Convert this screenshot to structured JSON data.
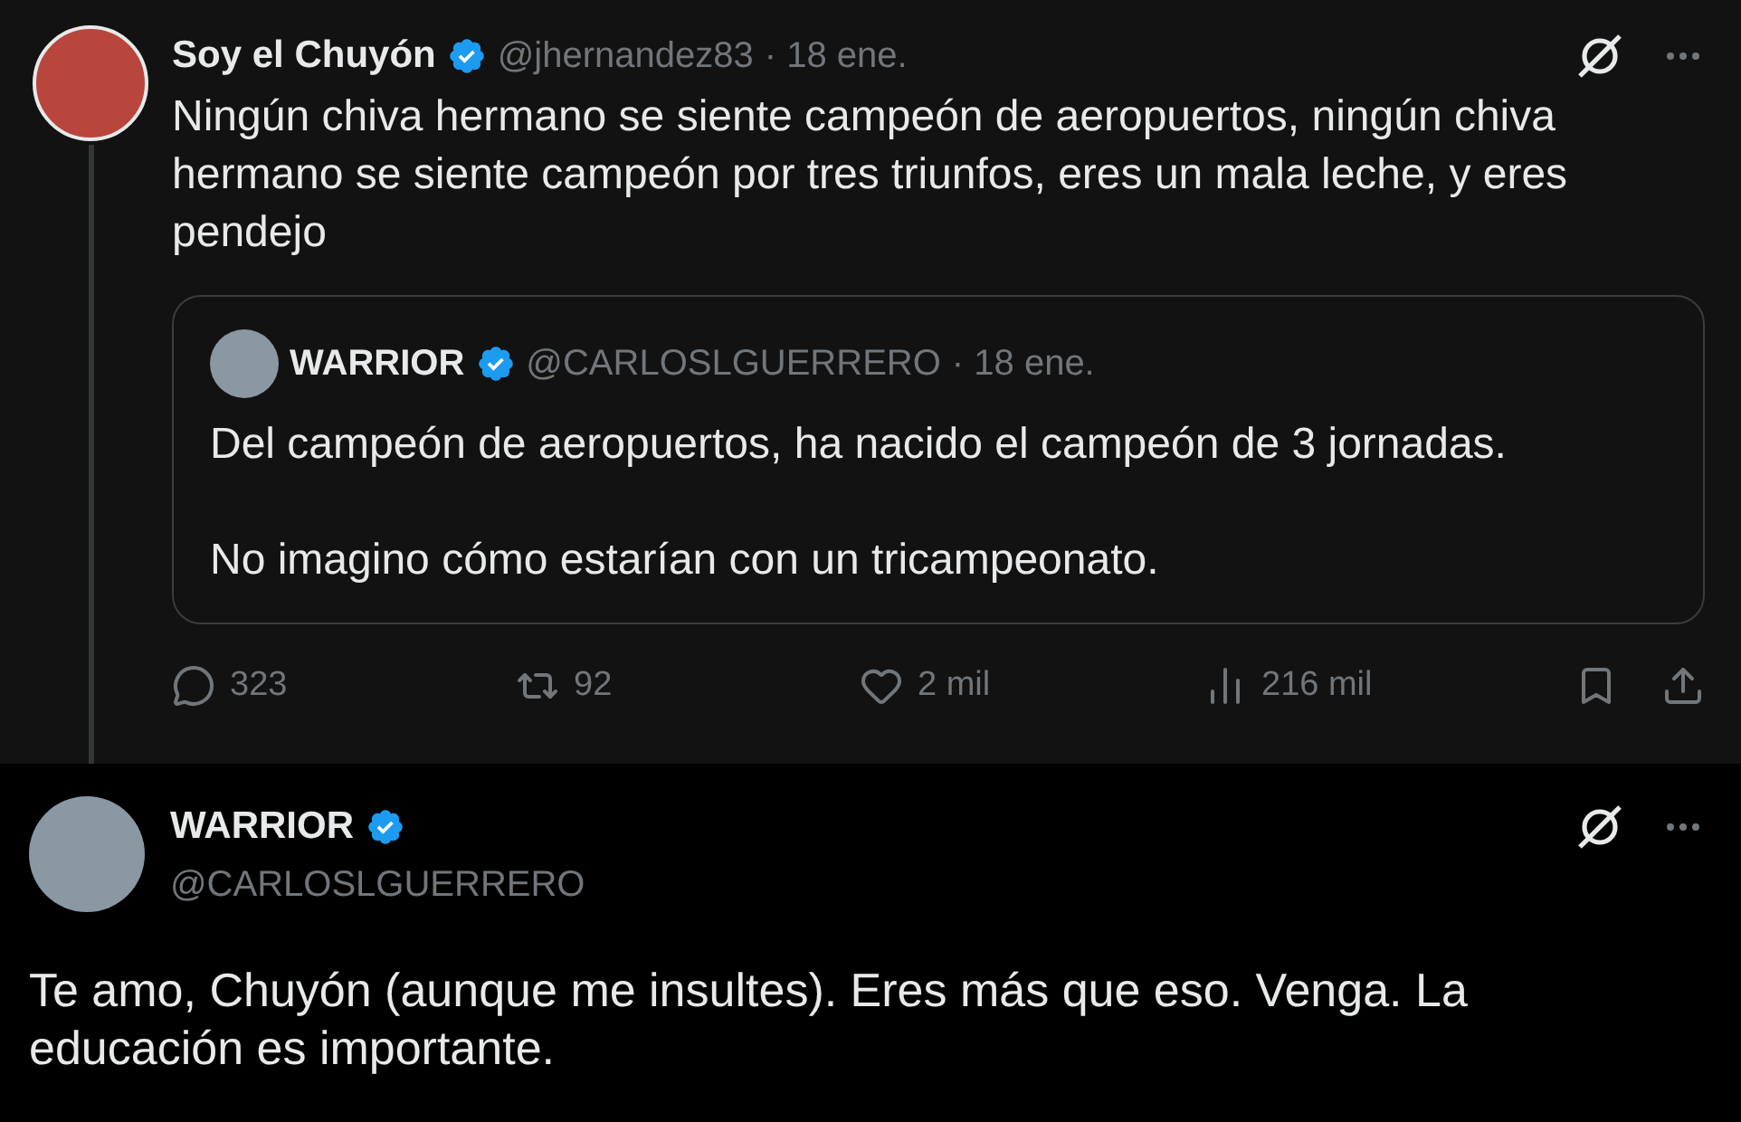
{
  "tweet": {
    "name": "Soy el Chuyón",
    "verified": true,
    "handle": "@jhernandez83",
    "date": "· 18 ene.",
    "text": "Ningún chiva hermano se siente campeón de aeropuertos, ningún chiva hermano se siente campeón por tres triunfos, eres un mala leche, y eres pendejo",
    "quote": {
      "name": "WARRIOR",
      "verified": true,
      "handle": "@CARLOSLGUERRERO",
      "date": "· 18 ene.",
      "paragraphs": [
        "Del campeón de aeropuertos, ha nacido el campeón de 3 jornadas.",
        "No imagino cómo estarían con un tricampeonato."
      ]
    },
    "actions": [
      {
        "kind": "reply",
        "count": "323"
      },
      {
        "kind": "retweet",
        "count": "92"
      },
      {
        "kind": "like",
        "count": "2 mil"
      },
      {
        "kind": "views",
        "count": "216 mil"
      }
    ]
  },
  "reply": {
    "name": "WARRIOR",
    "verified": true,
    "handle": "@CARLOSLGUERRERO",
    "text": "Te amo, Chuyón (aunque me insultes). Eres más que eso. Venga. La educación es importante."
  }
}
